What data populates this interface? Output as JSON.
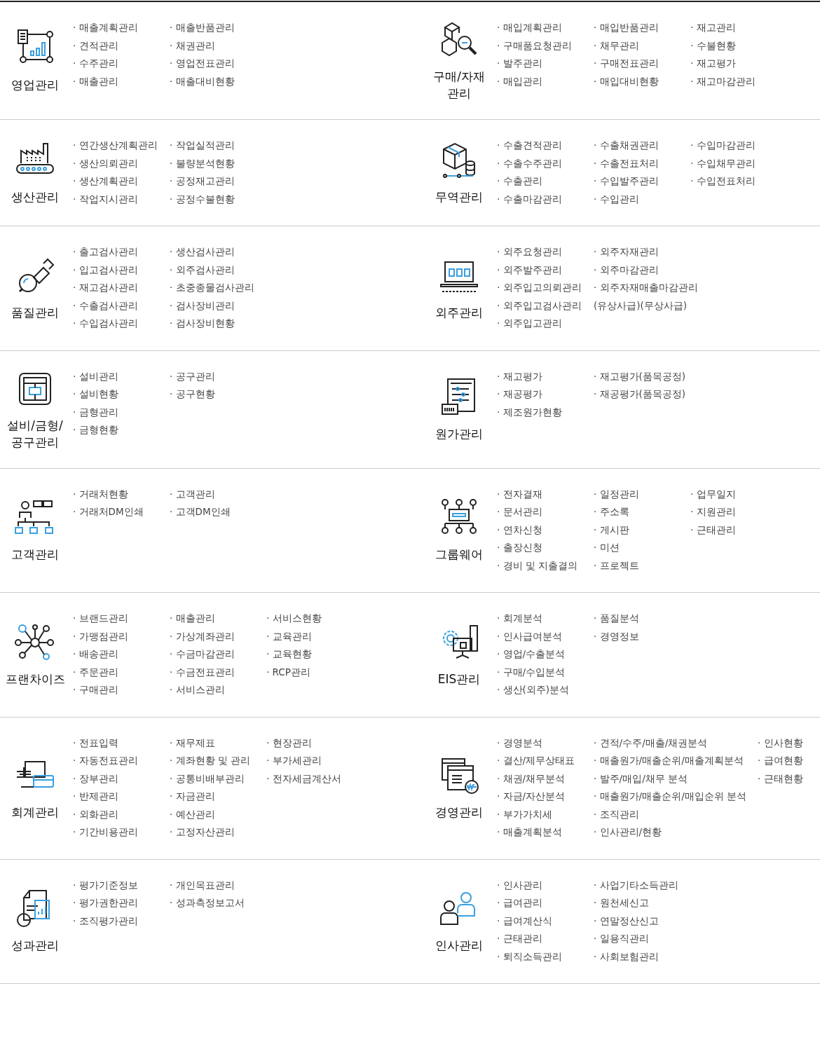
{
  "rows": [
    {
      "modules": [
        {
          "title": "영업관리",
          "columns": [
            [
              "· 매출계획관리",
              "· 견적관리",
              "· 수주관리",
              "· 매출관리"
            ],
            [
              "· 매출반품관리",
              "· 채권관리",
              "· 영업전표관리",
              "· 매출대비현황"
            ]
          ]
        },
        {
          "title": "구매/자재\n관리",
          "columns": [
            [
              "· 매입계획관리",
              "· 구매품요청관리",
              "· 발주관리",
              "· 매입관리"
            ],
            [
              "· 매입반품관리",
              "· 채무관리",
              "· 구매전표관리",
              "· 매입대비현황"
            ],
            [
              "· 재고관리",
              "· 수불현황",
              "· 재고평가",
              "· 재고마감관리"
            ]
          ]
        }
      ]
    },
    {
      "modules": [
        {
          "title": "생산관리",
          "columns": [
            [
              "· 연간생산계획관리",
              "· 생산의뢰관리",
              "· 생산계획관리",
              "· 작업지시관리"
            ],
            [
              "· 작업실적관리",
              "· 불량분석현황",
              "· 공정재고관리",
              "· 공정수불현황"
            ]
          ]
        },
        {
          "title": "무역관리",
          "columns": [
            [
              "· 수출견적관리",
              "· 수출수주관리",
              "· 수출관리",
              "· 수출마감관리"
            ],
            [
              "· 수출채권관리",
              "· 수출전표처리",
              "· 수입발주관리",
              "· 수입관리"
            ],
            [
              "· 수입마감관리",
              "· 수입채무관리",
              "· 수입전표처리"
            ]
          ]
        }
      ]
    },
    {
      "modules": [
        {
          "title": "품질관리",
          "columns": [
            [
              "· 출고검사관리",
              "· 입고검사관리",
              "· 재고검사관리",
              "· 수출검사관리",
              "· 수입검사관리"
            ],
            [
              "· 생산검사관리",
              "· 외주검사관리",
              "· 초중종물검사관리",
              "· 검사장비관리",
              "· 검사장비현황"
            ]
          ]
        },
        {
          "title": "외주관리",
          "columns": [
            [
              "· 외주요청관리",
              "· 외주발주관리",
              "· 외주입고의뢰관리",
              "· 외주입고검사관리",
              "· 외주입고관리"
            ],
            [
              "· 외주자재관리",
              "· 외주마감관리",
              "· 외주자재매출마감관리",
              "(유상사급)(무상사급)"
            ]
          ]
        }
      ]
    },
    {
      "modules": [
        {
          "title": "설비/금형/\n공구관리",
          "columns": [
            [
              "· 설비관리",
              "· 설비현황",
              "· 금형관리",
              "· 금형현황"
            ],
            [
              "· 공구관리",
              "· 공구현황"
            ]
          ]
        },
        {
          "title": "원가관리",
          "columns": [
            [
              "· 재고평가",
              "· 재공평가",
              "· 제조원가현황"
            ],
            [
              "· 재고평가(품목공정)",
              "· 재공평가(품목공정)"
            ]
          ]
        }
      ]
    },
    {
      "modules": [
        {
          "title": "고객관리",
          "columns": [
            [
              "· 거래처현황",
              "· 거래처DM인쇄"
            ],
            [
              "· 고객관리",
              "· 고객DM인쇄"
            ]
          ]
        },
        {
          "title": "그룹웨어",
          "columns": [
            [
              "· 전자결재",
              "· 문서관리",
              "· 연차신청",
              "· 출장신청",
              "· 경비 및 지출결의"
            ],
            [
              "· 일정관리",
              "· 주소록",
              "· 게시판",
              "· 미션",
              "· 프로젝트"
            ],
            [
              "· 업무일지",
              "· 지원관리",
              "· 근태관리"
            ]
          ]
        }
      ]
    },
    {
      "modules": [
        {
          "title": "프랜차이즈",
          "columns": [
            [
              "· 브랜드관리",
              "· 가맹점관리",
              "· 배송관리",
              "· 주문관리",
              "· 구매관리"
            ],
            [
              "· 매출관리",
              "· 가상계좌관리",
              "· 수금마감관리",
              "· 수금전표관리",
              "· 서비스관리"
            ],
            [
              "· 서비스현황",
              "· 교육관리",
              "· 교육현황",
              "· RCP관리"
            ]
          ]
        },
        {
          "title": "EIS관리",
          "columns": [
            [
              "· 회계분석",
              "· 인사급여분석",
              "· 영업/수출분석",
              "· 구매/수입분석",
              "· 생산(외주)분석"
            ],
            [
              "· 품질분석",
              "· 경영정보"
            ]
          ]
        }
      ]
    },
    {
      "modules": [
        {
          "title": "회계관리",
          "columns": [
            [
              "· 전표입력",
              "· 자동전표관리",
              "· 장부관리",
              "· 반제관리",
              "· 외화관리",
              "· 기간비용관리"
            ],
            [
              "· 재무제표",
              "· 계좌현황 및 관리",
              "· 공통비배부관리",
              "· 자금관리",
              "· 예산관리",
              "· 고정자산관리"
            ],
            [
              "· 현장관리",
              "· 부가세관리",
              "· 전자세금계산서"
            ]
          ]
        },
        {
          "title": "경영관리",
          "columns": [
            [
              "· 경영분석",
              "· 결산/제무상태표",
              "· 채권/채무분석",
              "· 자금/자산분석",
              "· 부가가치세",
              "· 매출계획분석"
            ],
            [
              "· 견적/수주/매출/채권분석",
              "· 매출원가/매출순위/매출계획분석",
              "· 발주/매입/채무 분석",
              "· 매출원가/매출순위/매입순위 분석",
              "· 조직관리",
              "· 인사관리/현황"
            ],
            [
              "· 인사현황",
              "· 급여현황",
              "· 근태현황"
            ]
          ]
        }
      ]
    },
    {
      "modules": [
        {
          "title": "성과관리",
          "columns": [
            [
              "· 평가기준정보",
              "· 평가권한관리",
              "· 조직평가관리"
            ],
            [
              "· 개인목표관리",
              "· 성과측정보고서"
            ]
          ]
        },
        {
          "title": "인사관리",
          "columns": [
            [
              "· 인사관리",
              "· 급여관리",
              "· 급여계산식",
              "· 근태관리",
              "· 퇴직소득관리"
            ],
            [
              "· 사업기타소득관리",
              "· 원천세신고",
              "· 연말정산신고",
              "· 일용직관리",
              "· 사회보험관리"
            ]
          ]
        }
      ]
    }
  ]
}
